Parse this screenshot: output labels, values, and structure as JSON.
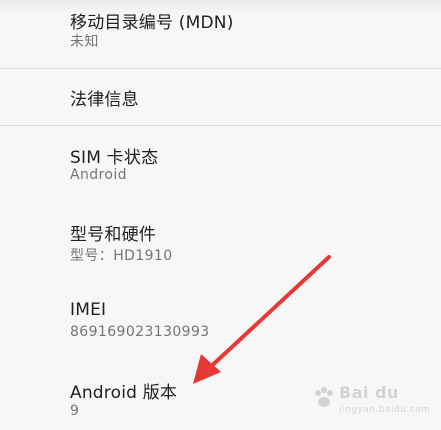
{
  "settings_items": [
    {
      "title": "移动目录编号 (MDN)",
      "summary": "未知"
    },
    {
      "title": "法律信息"
    },
    {
      "title": "SIM 卡状态",
      "summary": "Android"
    },
    {
      "title": "型号和硬件",
      "summary": "型号：HD1910"
    },
    {
      "title": "IMEI",
      "summary": "869169023130993"
    },
    {
      "title": "Android 版本",
      "summary": "9"
    }
  ],
  "annotation": {
    "arrow_color": "#e53935",
    "icon": "red-arrow-icon"
  },
  "watermark": {
    "brand": "Bai du",
    "sub": "jingyan.baidu.com"
  },
  "colors": {
    "background": "#f7f7f7",
    "title_text": "#212121",
    "summary_text": "#757575",
    "divider": "#dedede"
  }
}
